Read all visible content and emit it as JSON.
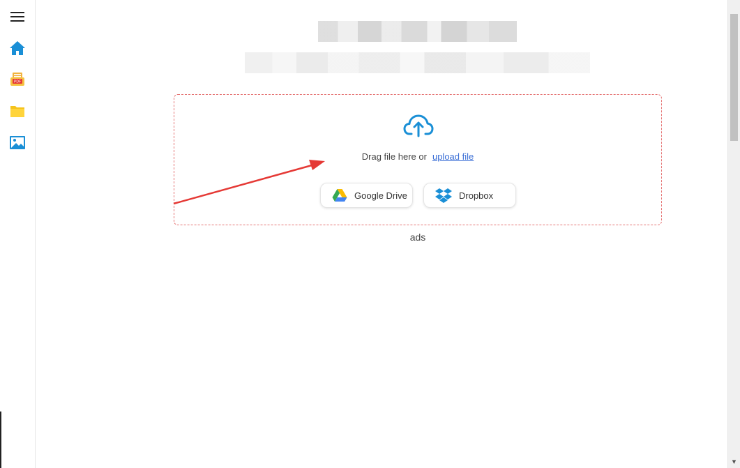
{
  "sidebar": {
    "items": [
      {
        "name": "menu",
        "icon": "hamburger-menu-icon"
      },
      {
        "name": "home",
        "icon": "home-icon"
      },
      {
        "name": "pdf",
        "icon": "pdf-printer-icon"
      },
      {
        "name": "folder",
        "icon": "folder-icon"
      },
      {
        "name": "image",
        "icon": "image-icon"
      }
    ]
  },
  "header": {
    "title": "",
    "subtitle": ""
  },
  "upload": {
    "drag_text": "Drag file here or",
    "upload_link": "upload file",
    "providers": [
      {
        "label": "Google Drive",
        "icon": "google-drive-icon"
      },
      {
        "label": "Dropbox",
        "icon": "dropbox-icon"
      }
    ]
  },
  "ads_label": "ads",
  "colors": {
    "accent_blue": "#1a8fd6",
    "link_blue": "#3b6fd6",
    "dropzone_border": "#e57373",
    "annotation_red": "#e53935"
  }
}
